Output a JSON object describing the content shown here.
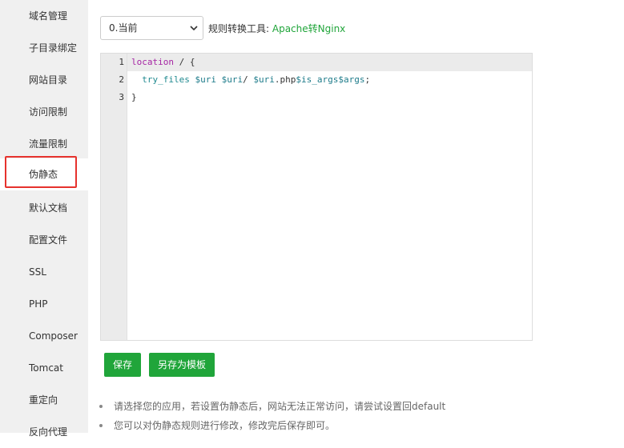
{
  "sidebar": {
    "items": [
      {
        "label": "域名管理"
      },
      {
        "label": "子目录绑定"
      },
      {
        "label": "网站目录"
      },
      {
        "label": "访问限制"
      },
      {
        "label": "流量限制"
      },
      {
        "label": "伪静态",
        "active": true
      },
      {
        "label": "默认文档"
      },
      {
        "label": "配置文件"
      },
      {
        "label": "SSL"
      },
      {
        "label": "PHP"
      },
      {
        "label": "Composer"
      },
      {
        "label": "Tomcat"
      },
      {
        "label": "重定向"
      },
      {
        "label": "反向代理"
      }
    ]
  },
  "rewrite": {
    "select_value": "0.当前",
    "tool_label": "规则转换工具:",
    "tool_link": "Apache转Nginx"
  },
  "editor": {
    "line_numbers": [
      "1",
      "2",
      "3"
    ],
    "lines": {
      "l1_kw": "location",
      "l1_rest": " / {",
      "l2_fn": "try_files",
      "l2_v1": "$uri",
      "l2_v2": "$uri",
      "l2_mid": "/ ",
      "l2_v3": "$uri",
      "l2_php": ".php",
      "l2_v4": "$is_args",
      "l2_v5": "$args",
      "l2_end": ";",
      "l3": "}"
    }
  },
  "buttons": {
    "save": "保存",
    "save_as_template": "另存为模板"
  },
  "tips": [
    "请选择您的应用，若设置伪静态后，网站无法正常访问，请尝试设置回default",
    "您可以对伪静态规则进行修改，修改完后保存即可。"
  ],
  "colors": {
    "accent": "#20a53a",
    "highlight_outline": "#e6322d",
    "sidebar_bg": "#f0f0f0"
  }
}
